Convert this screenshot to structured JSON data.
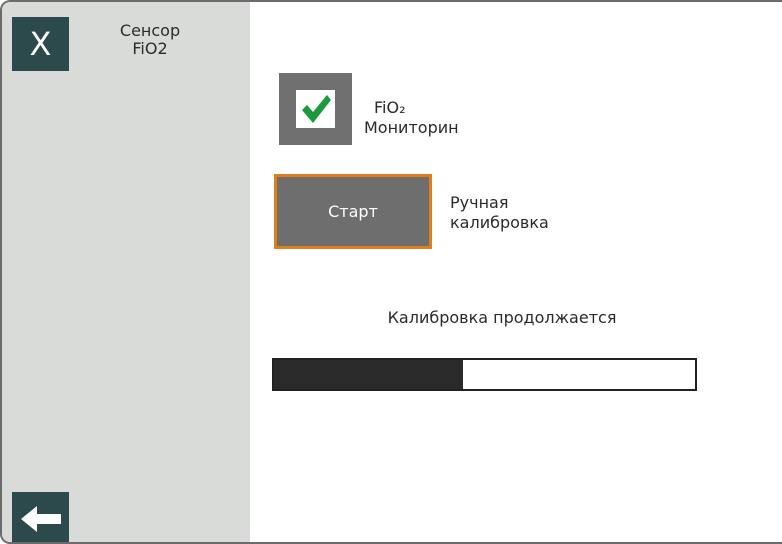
{
  "sidebar": {
    "close_label": "X",
    "title_line1": "Сенсор",
    "title_line2": "FiO2",
    "back_icon": "arrow-left-icon"
  },
  "monitoring": {
    "checked": true,
    "label_line1": "FiO₂",
    "label_line2": "Мониторин",
    "check_icon": "checkmark-icon",
    "check_color": "#1a9a3a"
  },
  "calibration": {
    "start_label": "Старт",
    "label_line1": "Ручная",
    "label_line2": "калибровка"
  },
  "progress": {
    "status_text": "Калибровка продолжается",
    "fraction": 0.45
  },
  "colors": {
    "accent_border": "#e07f1a",
    "button_dark": "#2c4a4b",
    "tile_gray": "#707070"
  }
}
